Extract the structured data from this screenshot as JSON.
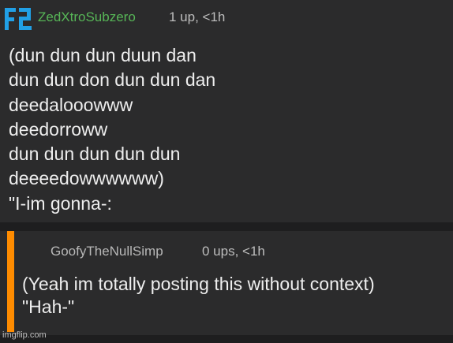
{
  "colors": {
    "background": "#2b2b2c",
    "divider": "#1e1e1f",
    "username_green": "#57b657",
    "avatar_blue": "#21a0e6",
    "thread_bar_orange": "#ff8c00"
  },
  "comment": {
    "avatar_icon": "flag-logo-icon",
    "username": "ZedXtroSubzero",
    "meta": "1 up, <1h",
    "lines": [
      "(dun dun dun duun dan",
      "dun dun don dun dun dan",
      "deedalooowww",
      "deedorroww",
      "dun dun dun dun dun",
      "deeeedowwwwww)",
      "\"I-im gonna-:"
    ]
  },
  "reply": {
    "username": "GoofyTheNullSimp",
    "meta": "0 ups, <1h",
    "lines": [
      "(Yeah im totally posting this without context)",
      "\"Hah-\""
    ]
  },
  "watermark": "imgflip.com"
}
